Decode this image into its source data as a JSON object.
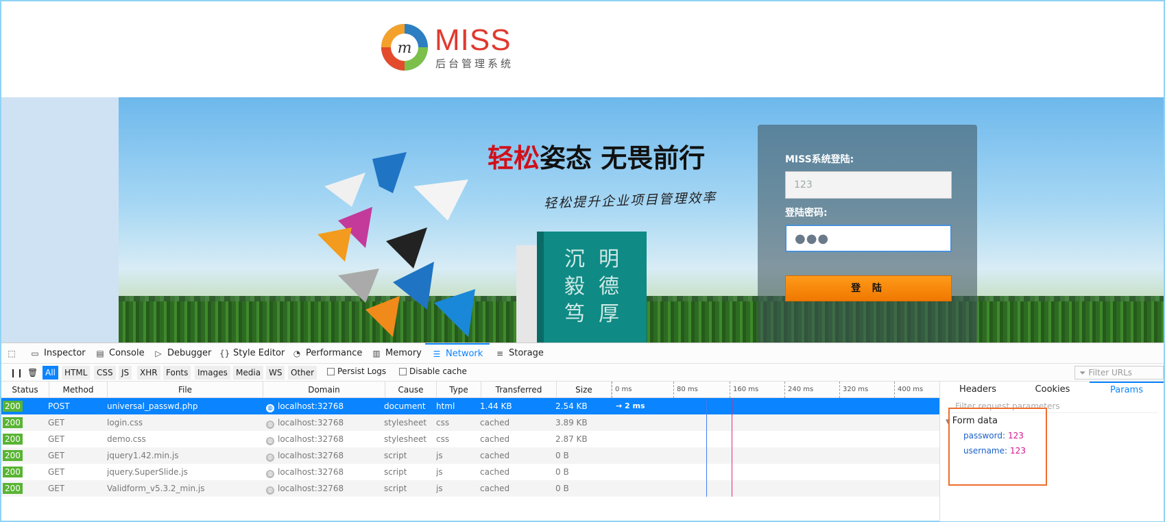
{
  "site": {
    "logo_title": "MISS",
    "logo_subtitle": "后台管理系统",
    "slogan_red": "轻松",
    "slogan_black": "姿态 无畏前行",
    "slogan_sub": "轻松提升企业项目管理效率",
    "book_text": [
      "沉",
      "毅",
      "笃",
      "明",
      "德",
      "厚"
    ]
  },
  "login": {
    "user_label": "MISS系统登陆:",
    "user_value": "123",
    "pass_label": "登陆密码:",
    "pass_dots": "●●●",
    "submit_label": "登 陆"
  },
  "devtools": {
    "tabs": [
      {
        "label": "Inspector",
        "icon": "inspector-icon"
      },
      {
        "label": "Console",
        "icon": "console-icon"
      },
      {
        "label": "Debugger",
        "icon": "debugger-icon"
      },
      {
        "label": "Style Editor",
        "icon": "style-editor-icon"
      },
      {
        "label": "Performance",
        "icon": "performance-icon"
      },
      {
        "label": "Memory",
        "icon": "memory-icon"
      },
      {
        "label": "Network",
        "icon": "network-icon",
        "active": true
      },
      {
        "label": "Storage",
        "icon": "storage-icon"
      }
    ],
    "filters": [
      "All",
      "HTML",
      "CSS",
      "JS",
      "XHR",
      "Fonts",
      "Images",
      "Media",
      "WS",
      "Other"
    ],
    "persist_logs": "Persist Logs",
    "disable_cache": "Disable cache",
    "filter_urls_placeholder": "Filter URLs",
    "columns": [
      "Status",
      "Method",
      "File",
      "Domain",
      "Cause",
      "Type",
      "Transferred",
      "Size"
    ],
    "timeline_ticks": [
      "0 ms",
      "80 ms",
      "160 ms",
      "240 ms",
      "320 ms",
      "400 ms"
    ],
    "requests": [
      {
        "status": "200",
        "method": "POST",
        "file": "universal_passwd.php",
        "domain": "localhost:32768",
        "cause": "document",
        "type": "html",
        "transferred": "1.44 KB",
        "size": "2.54 KB",
        "timing": "→ 2 ms"
      },
      {
        "status": "200",
        "method": "GET",
        "file": "login.css",
        "domain": "localhost:32768",
        "cause": "stylesheet",
        "type": "css",
        "transferred": "cached",
        "size": "3.89 KB"
      },
      {
        "status": "200",
        "method": "GET",
        "file": "demo.css",
        "domain": "localhost:32768",
        "cause": "stylesheet",
        "type": "css",
        "transferred": "cached",
        "size": "2.87 KB"
      },
      {
        "status": "200",
        "method": "GET",
        "file": "jquery1.42.min.js",
        "domain": "localhost:32768",
        "cause": "script",
        "type": "js",
        "transferred": "cached",
        "size": "0 B"
      },
      {
        "status": "200",
        "method": "GET",
        "file": "jquery.SuperSlide.js",
        "domain": "localhost:32768",
        "cause": "script",
        "type": "js",
        "transferred": "cached",
        "size": "0 B"
      },
      {
        "status": "200",
        "method": "GET",
        "file": "Validform_v5.3.2_min.js",
        "domain": "localhost:32768",
        "cause": "script",
        "type": "js",
        "transferred": "cached",
        "size": "0 B"
      }
    ],
    "side_tabs": [
      "Headers",
      "Cookies",
      "Params"
    ],
    "params_filter_placeholder": "Filter request parameters",
    "form_data_label": "Form data",
    "params": [
      {
        "key": "password:",
        "value": "123"
      },
      {
        "key": "username:",
        "value": "123"
      }
    ]
  },
  "colors": {
    "accent": "#0a84ff",
    "status_ok": "#58b433",
    "brand_red": "#e03a2f",
    "button_orange": "#f07800",
    "highlight": "#ef6c2b"
  }
}
